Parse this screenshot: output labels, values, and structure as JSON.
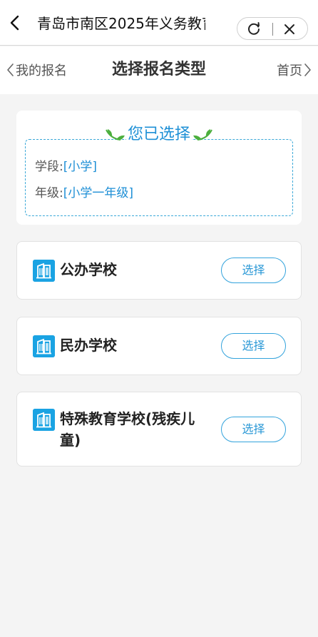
{
  "window": {
    "title": "青岛市南区2025年义务教育"
  },
  "subnav": {
    "prev_label": "我的报名",
    "title": "选择报名类型",
    "next_label": "首页"
  },
  "selection": {
    "heading": "您已选择",
    "rows": [
      {
        "label": "学段:",
        "value": "[小学]"
      },
      {
        "label": "年级:",
        "value": "[小学一年级]"
      }
    ]
  },
  "options": [
    {
      "label": "公办学校",
      "button": "选择"
    },
    {
      "label": "民办学校",
      "button": "选择"
    },
    {
      "label_line1": "特殊教育学校(残疾儿",
      "label_line2": "童)",
      "button": "选择"
    }
  ],
  "colors": {
    "accent": "#1aa3e3",
    "accent_text": "#1e8fd6",
    "leaf": "#4caf3e",
    "background": "#f4f4f4"
  },
  "icons": {
    "back": "chevron-left-icon",
    "refresh": "refresh-icon",
    "close": "close-icon",
    "school": "building-icon",
    "leaf": "leaf-icon"
  }
}
